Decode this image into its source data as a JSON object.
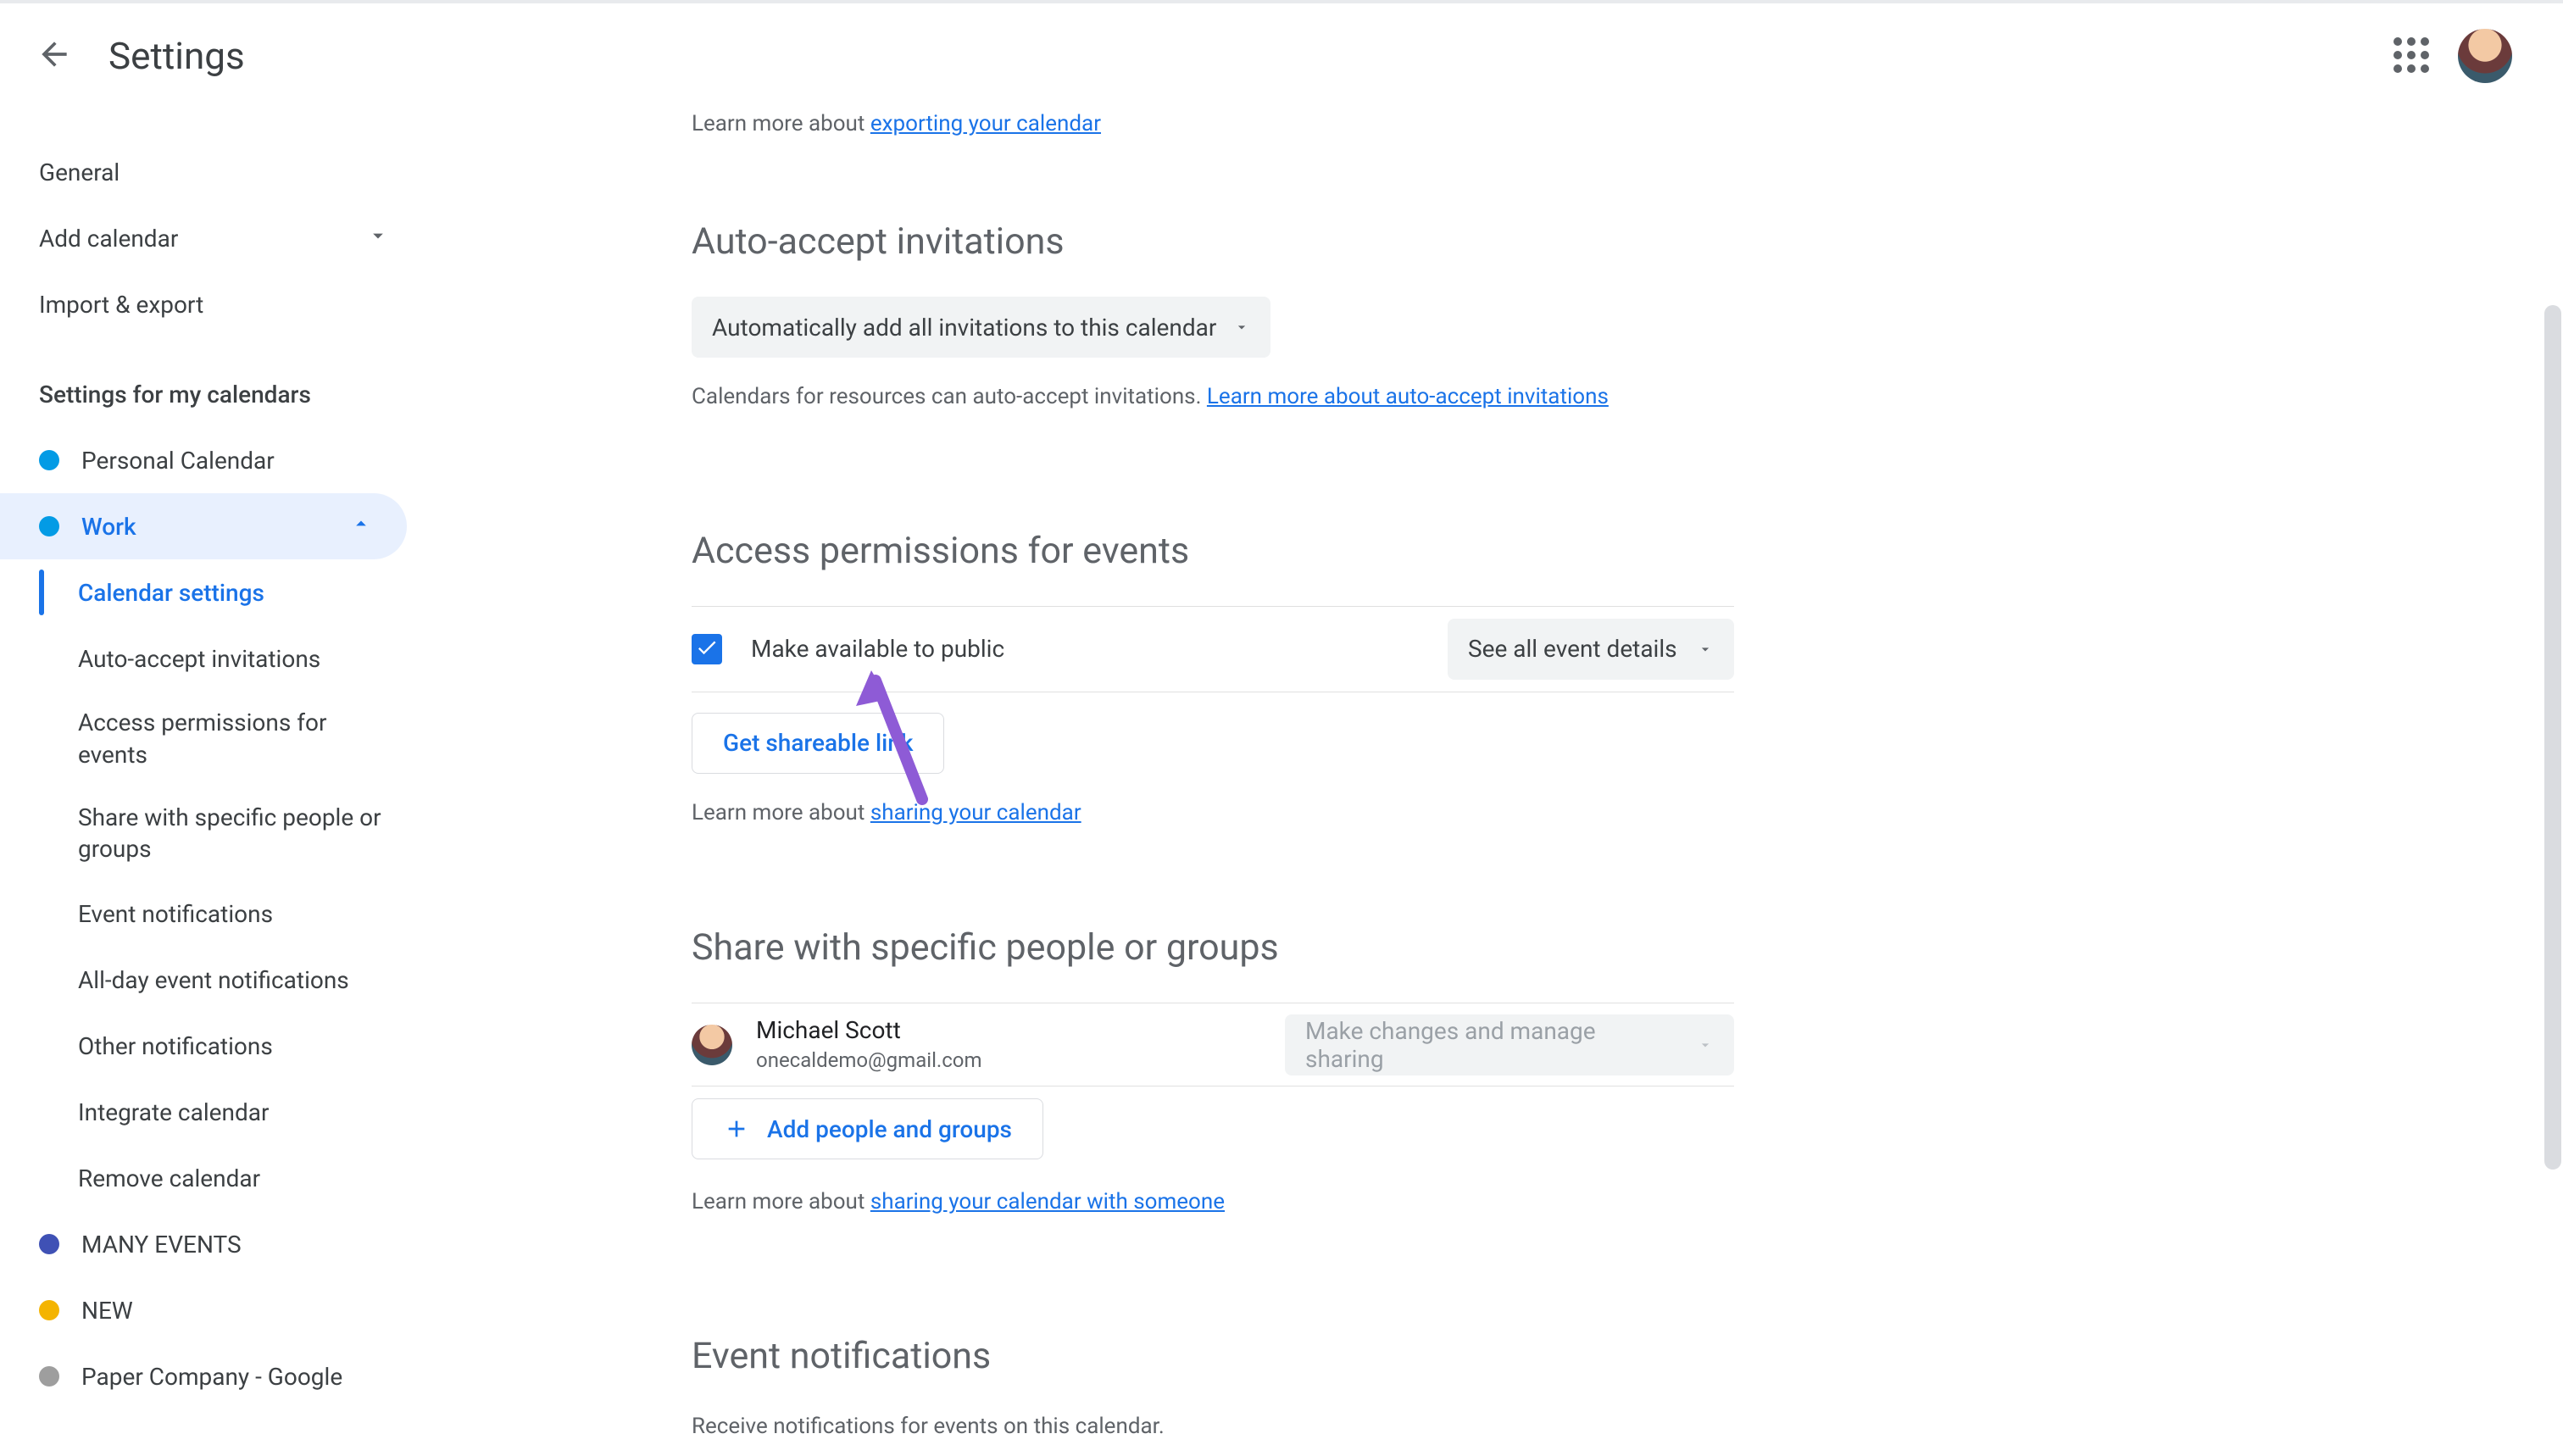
{
  "header": {
    "title": "Settings"
  },
  "sidebar": {
    "top": {
      "general": "General",
      "add_calendar": "Add calendar",
      "import_export": "Import & export"
    },
    "section_header": "Settings for my calendars",
    "calendars": {
      "personal": {
        "label": "Personal Calendar",
        "color": "#039be5"
      },
      "work": {
        "label": "Work",
        "color": "#039be5"
      },
      "many": {
        "label": "MANY EVENTS",
        "color": "#3f51b5"
      },
      "new": {
        "label": "NEW",
        "color": "#f4b400"
      },
      "paper": {
        "label": "Paper Company - Google",
        "color": "#9e9e9e"
      }
    },
    "work_sub": {
      "calendar_settings": "Calendar settings",
      "auto_accept": "Auto-accept invitations",
      "access_perms": "Access permissions for events",
      "share_people": "Share with specific people or groups",
      "event_notif": "Event notifications",
      "all_day_notif": "All-day event notifications",
      "other_notif": "Other notifications",
      "integrate": "Integrate calendar",
      "remove": "Remove calendar"
    }
  },
  "main": {
    "export_hint_prefix": "Learn more about ",
    "export_link": "exporting your calendar",
    "auto_accept": {
      "title": "Auto-accept invitations",
      "selected": "Automatically add all invitations to this calendar",
      "hint_prefix": "Calendars for resources can auto-accept invitations. ",
      "hint_link": "Learn more about auto-accept invitations"
    },
    "access": {
      "title": "Access permissions for events",
      "checkbox_label": "Make available to public",
      "select_value": "See all event details",
      "get_link": "Get shareable link",
      "hint_prefix": "Learn more about ",
      "hint_link": "sharing your calendar"
    },
    "share": {
      "title": "Share with specific people or groups",
      "person_name": "Michael Scott",
      "person_email": "onecaldemo@gmail.com",
      "person_perm": "Make changes and manage sharing",
      "add_btn": "Add people and groups",
      "hint_prefix": "Learn more about ",
      "hint_link": "sharing your calendar with someone"
    },
    "notif": {
      "title": "Event notifications",
      "desc": "Receive notifications for events on this calendar."
    }
  },
  "colors": {
    "accent": "#1a73e8"
  }
}
